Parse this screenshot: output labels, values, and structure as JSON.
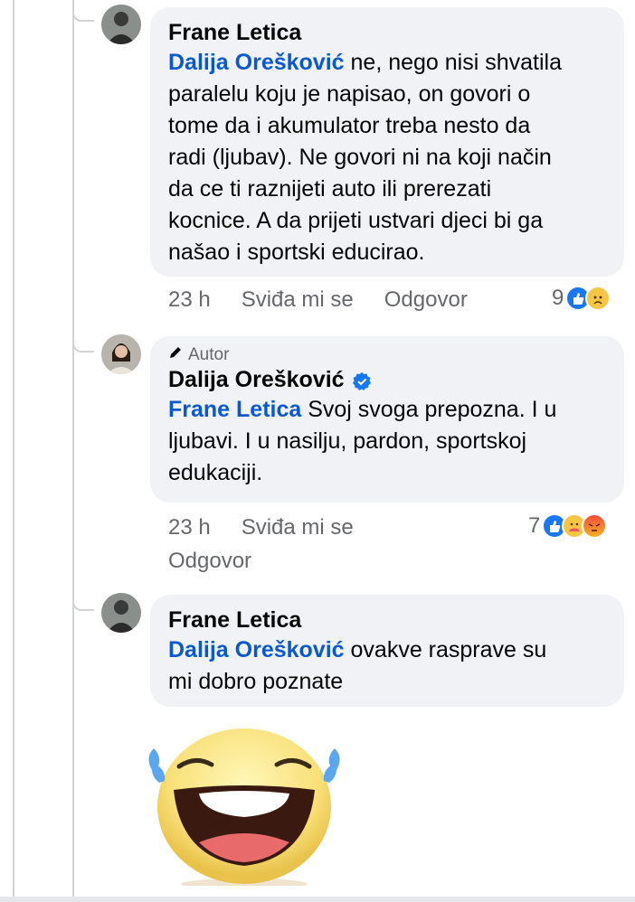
{
  "comments": [
    {
      "author": "Frane Letica",
      "mention": "Dalija Orešković",
      "text_lines": [
        " ne, nego nisi shvatila",
        "paralelu koju je napisao, on govori o",
        "tome da i akumulator treba nesto da",
        "radi (ljubav). Ne govori ni na koji način",
        "da ce ti raznijeti auto ili prerezati",
        "kocnice. A da prijeti ustvari djeci bi ga",
        "našao i sportski educirao."
      ],
      "time": "23 h",
      "like_label": "Sviđa mi se",
      "reply_label": "Odgovor",
      "reaction_count": "9",
      "reactions": [
        "like-reaction-icon",
        "sad-reaction-icon"
      ]
    },
    {
      "badge": "Autor",
      "author": "Dalija Orešković",
      "verified": true,
      "mention": "Frane Letica",
      "text_lines": [
        " Svoj svoga prepozna. I u",
        "ljubavi. I u nasilju, pardon, sportskoj",
        "edukaciji."
      ],
      "time": "23 h",
      "like_label": "Sviđa mi se",
      "reply_label": "Odgovor",
      "reaction_count": "7",
      "reactions": [
        "like-reaction-icon",
        "care-reaction-icon",
        "angry-reaction-icon"
      ]
    },
    {
      "author": "Frane Letica",
      "mention": "Dalija Orešković",
      "text_lines": [
        " ovakve rasprave su",
        "mi dobro poznate"
      ],
      "sticker": "laughing-tears-emoji"
    }
  ],
  "colors": {
    "mention": "#0a58d0",
    "bubble": "#f0f2f5",
    "like": "#1877f2",
    "meta": "#65676b"
  }
}
